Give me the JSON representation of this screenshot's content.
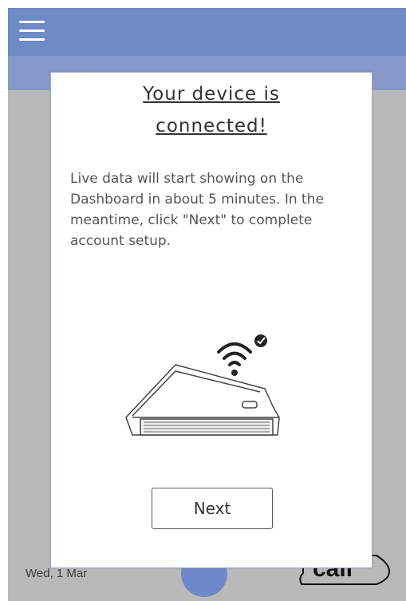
{
  "topbar": {
    "menu_icon": "hamburger-menu-icon"
  },
  "background": {
    "date": "Wed, 1 Mar",
    "call_label": "call"
  },
  "modal": {
    "title_line1": "Your device is",
    "title_line2": "connected!",
    "body": "Live data will start showing on the Dashboard in about 5 minutes. In the meantime, click \"Next\" to complete account setup.",
    "illustration": "device-connected-illustration",
    "next_label": "Next"
  },
  "colors": {
    "topbar": "#6f8bc5",
    "subbar": "#8799c9",
    "overlay": "#b9b9b9",
    "modal_border": "#9aaad4"
  }
}
